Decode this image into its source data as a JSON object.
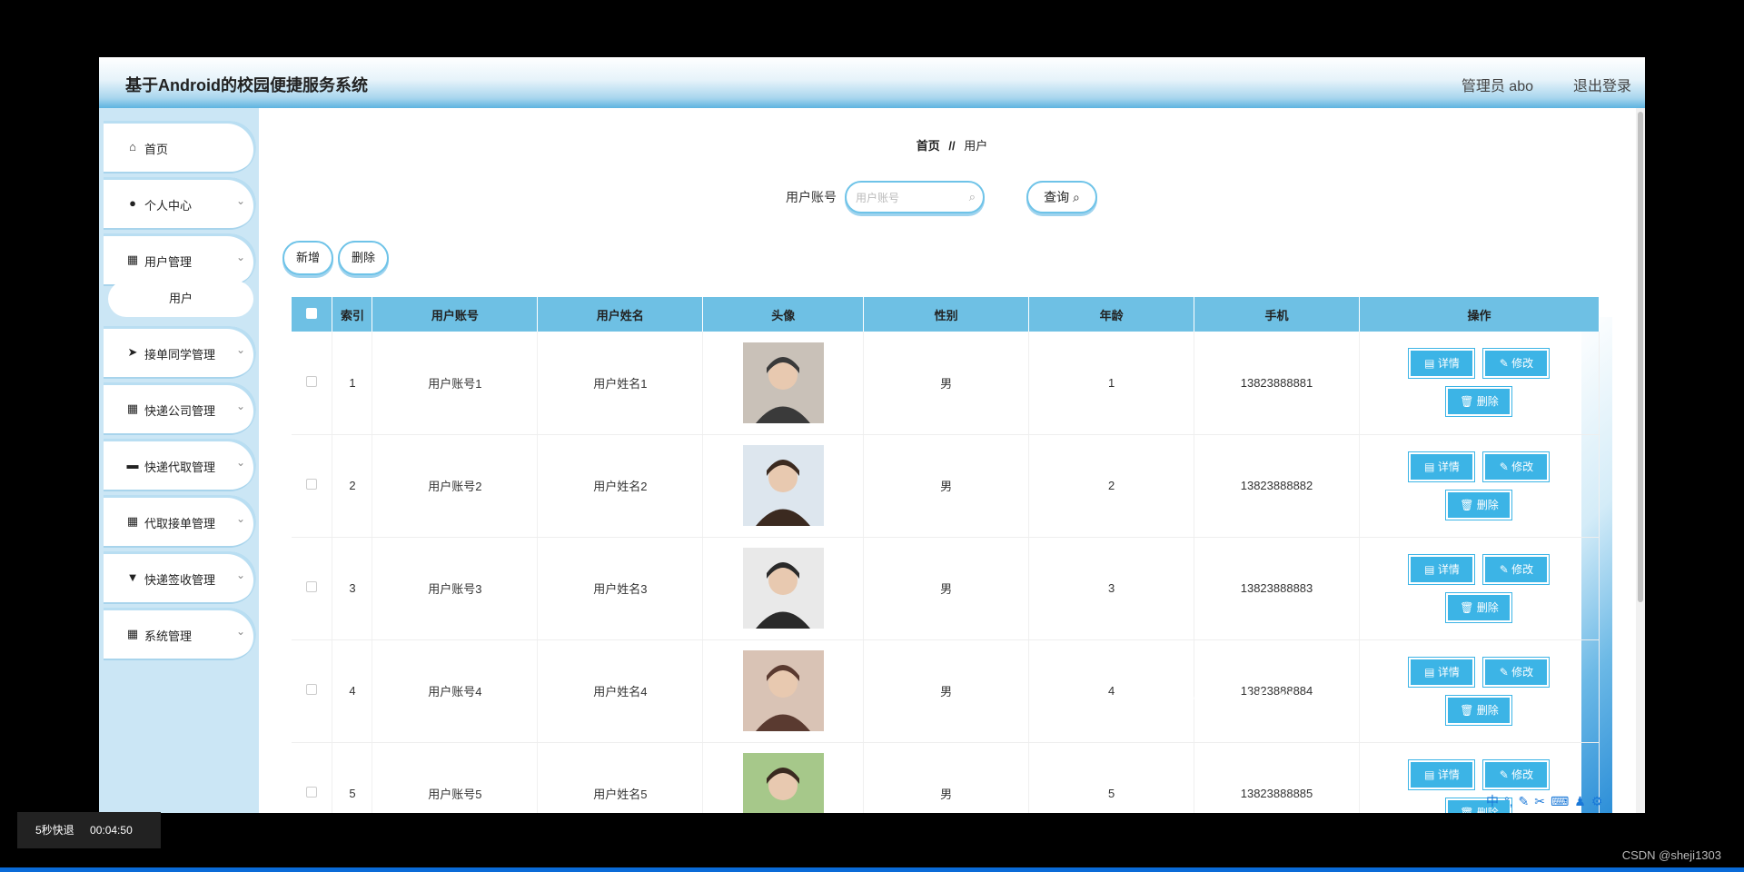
{
  "app": {
    "title": "基于Android的校园便捷服务系统",
    "user": "管理员 abo",
    "logout": "退出登录"
  },
  "sidebar": {
    "items": [
      {
        "label": "首页",
        "icon": "home-icon",
        "glyph": "⌂",
        "chevron": ""
      },
      {
        "label": "个人中心",
        "icon": "person-icon",
        "glyph": "●",
        "chevron": "⌄"
      },
      {
        "label": "用户管理",
        "icon": "grid-icon",
        "glyph": "▦",
        "chevron": "⌄"
      },
      {
        "label": "接单同学管理",
        "icon": "send-icon",
        "glyph": "➤",
        "chevron": "⌄"
      },
      {
        "label": "快递公司管理",
        "icon": "apps-icon",
        "glyph": "▦",
        "chevron": "⌄"
      },
      {
        "label": "快递代取管理",
        "icon": "message-icon",
        "glyph": "▬",
        "chevron": "⌄"
      },
      {
        "label": "代取接单管理",
        "icon": "apps-icon",
        "glyph": "▦",
        "chevron": "⌄"
      },
      {
        "label": "快递签收管理",
        "icon": "stamp-icon",
        "glyph": "▼",
        "chevron": "⌄"
      },
      {
        "label": "系统管理",
        "icon": "apps-icon",
        "glyph": "▦",
        "chevron": "⌄"
      }
    ],
    "sub_item": "用户"
  },
  "breadcrumb": {
    "home": "首页",
    "sep": "//",
    "current": "用户"
  },
  "search": {
    "label": "用户账号",
    "placeholder": "用户账号",
    "button": "查询"
  },
  "actions": {
    "add": "新增",
    "delete": "删除"
  },
  "table": {
    "headers": [
      "索引",
      "用户账号",
      "用户姓名",
      "头像",
      "性别",
      "年龄",
      "手机",
      "操作"
    ],
    "rows": [
      {
        "index": "1",
        "account": "用户账号1",
        "name": "用户姓名1",
        "gender": "男",
        "age": "1",
        "phone": "13823888881"
      },
      {
        "index": "2",
        "account": "用户账号2",
        "name": "用户姓名2",
        "gender": "男",
        "age": "2",
        "phone": "13823888882"
      },
      {
        "index": "3",
        "account": "用户账号3",
        "name": "用户姓名3",
        "gender": "男",
        "age": "3",
        "phone": "13823888883"
      },
      {
        "index": "4",
        "account": "用户账号4",
        "name": "用户姓名4",
        "gender": "男",
        "age": "4",
        "phone": "13823888884"
      },
      {
        "index": "5",
        "account": "用户账号5",
        "name": "用户姓名5",
        "gender": "男",
        "age": "5",
        "phone": "13823888885"
      }
    ],
    "ops": {
      "detail": "详情",
      "edit": "修改",
      "delete": "删除"
    }
  },
  "player": {
    "skip_label": "5秒快退",
    "time": "00:04:50",
    "credit": "CSDN @sheji1303"
  },
  "colors": {
    "accent": "#3cb4e6",
    "header": "#6ec0e4",
    "sidebar": "#cbe6f5"
  }
}
